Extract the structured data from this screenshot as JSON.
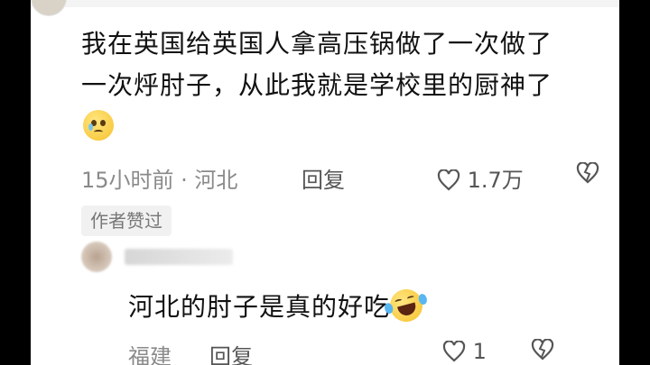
{
  "comment": {
    "text": "我在英国给英国人拿高压锅做了一次做了一次烀肘子，从此我就是学校里的厨神了",
    "emoji": "pleading-face-icon",
    "time": "15小时前 · 河北",
    "reply_label": "回复",
    "like_count": "1.7万",
    "author_badge": "作者赞过"
  },
  "reply": {
    "text": "河北的肘子是真的好吃",
    "emoji": "rolling-laughing-face-icon",
    "location": "福建",
    "reply_label": "回复",
    "like_count": "1"
  },
  "colors": {
    "text_primary": "#111111",
    "text_secondary": "#8a8a8a",
    "badge_bg": "#f1f1f1",
    "page_bg": "#000000",
    "card_bg": "#ffffff"
  }
}
